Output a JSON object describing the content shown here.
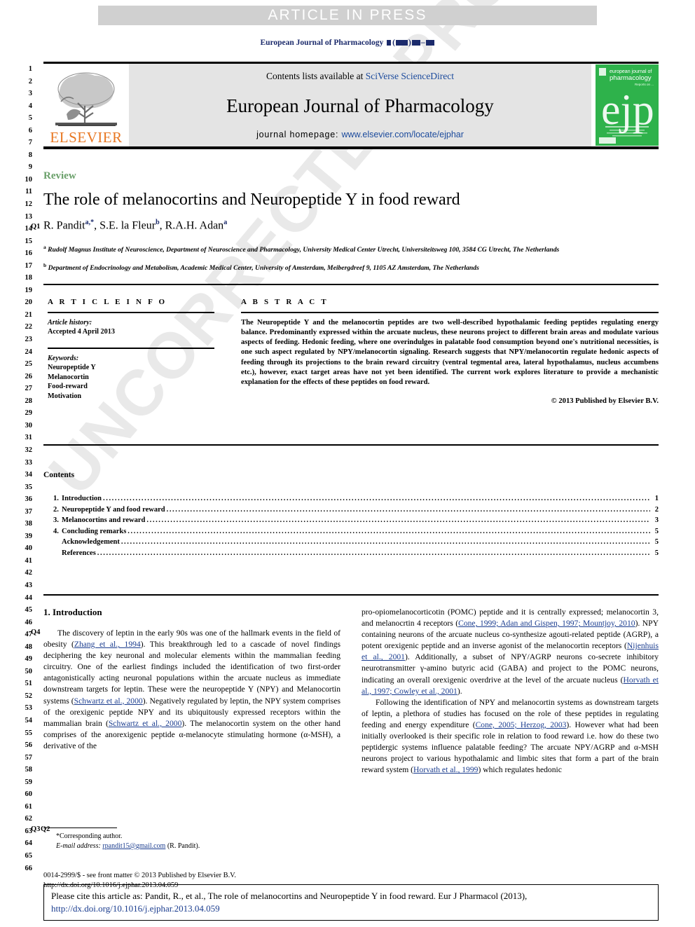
{
  "header": {
    "article_in_press": "ARTICLE IN PRESS",
    "running_head_prefix": "European Journal of Pharmacology"
  },
  "masthead": {
    "contents_prefix": "Contents lists available at ",
    "contents_link": "SciVerse ScienceDirect",
    "journal_name": "European Journal of Pharmacology",
    "homepage_prefix": "journal homepage: ",
    "homepage_link": "www.elsevier.com/locate/ejphar",
    "publisher": "ELSEVIER",
    "cover_title_line1": "european journal of",
    "cover_title_line2": "pharmacology",
    "cover_logo": "ejp"
  },
  "article": {
    "type_label": "Review",
    "title": "The role of melanocortins and Neuropeptide Y in food reward",
    "authors_html": "R. Pandit, S.E. la Fleur, R.A.H. Adan",
    "author1": "R. Pandit",
    "author1_sup": "a,*",
    "author2": "S.E. la Fleur",
    "author2_sup": "b",
    "author3": "R.A.H. Adan",
    "author3_sup": "a",
    "affiliation_a": "Rudolf Magnus Institute of Neuroscience, Department of Neuroscience and Pharmacology, University Medical Center Utrecht, Universiteitsweg 100, 3584 CG Utrecht, The Netherlands",
    "affiliation_b": "Department of Endocrinology and Metabolism, Academic Medical Center, University of Amsterdam, Meibergdreef 9, 1105 AZ Amsterdam, The Netherlands"
  },
  "info": {
    "heading": "A R T I C L E   I N F O",
    "history_label": "Article history:",
    "history_value": "Accepted 4 April 2013",
    "keywords_label": "Keywords:",
    "keywords": [
      "Neuropeptide Y",
      "Melanocortin",
      "Food-reward",
      "Motivation"
    ]
  },
  "abstract": {
    "heading": "A B S T R A C T",
    "text": "The Neuropeptide Y and the melanocortin peptides are two well-described hypothalamic feeding peptides regulating energy balance. Predominantly expressed within the arcuate nucleus, these neurons project to different brain areas and modulate various aspects of feeding. Hedonic feeding, where one overindulges in palatable food consumption beyond one's nutritional necessities, is one such aspect regulated by NPY/melanocortin signaling. Research suggests that NPY/melanocortin regulate hedonic aspects of feeding through its projections to the brain reward circuitry (ventral tegmental area, lateral hypothalamus, nucleus accumbens etc.), however, exact target areas have not yet been identified. The current work explores literature to provide a mechanistic explanation for the effects of these peptides on food reward.",
    "copyright": "© 2013 Published by Elsevier B.V."
  },
  "contents": {
    "heading": "Contents",
    "entries": [
      {
        "num": "1.",
        "label": "Introduction",
        "page": "1"
      },
      {
        "num": "2.",
        "label": "Neuropeptide Y and food reward",
        "page": "2"
      },
      {
        "num": "3.",
        "label": "Melanocortins and reward",
        "page": "3"
      },
      {
        "num": "4.",
        "label": "Concluding remarks",
        "page": "5"
      },
      {
        "num": "",
        "label": "Acknowledgement",
        "page": "5"
      },
      {
        "num": "",
        "label": "References",
        "page": "5"
      }
    ]
  },
  "body": {
    "section1_heading": "1.  Introduction",
    "left_para1_a": "The discovery of leptin in the early 90s was one of the hallmark events in the field of obesity (",
    "left_para1_ref1": "Zhang et al., 1994",
    "left_para1_b": "). This breakthrough led to a cascade of novel findings deciphering the key neuronal and molecular elements within the mammalian feeding circuitry. One of the earliest findings included the identification of two first-order antagonistically acting neuronal populations within the arcuate nucleus as immediate downstream targets for leptin. These were the neuropeptide Y (NPY) and Melanocortin systems (",
    "left_para1_ref2": "Schwartz et al., 2000",
    "left_para1_c": "). Negatively regulated by leptin, the NPY system comprises of the orexigenic peptide NPY and its ubiquitously expressed receptors within the mammalian brain (",
    "left_para1_ref3": "Schwartz et al., 2000",
    "left_para1_d": "). The melanocortin system on the other hand comprises of the anorexigenic peptide α-melanocyte stimulating hormone (α-MSH), a derivative of the ",
    "right_para1_a": "pro-opiomelanocorticotin (POMC) peptide and it is centrally expressed; melanocortin 3, and melanocrtin 4 receptors (",
    "right_para1_ref1": "Cone, 1999; Adan and Gispen, 1997; Mountjoy, 2010",
    "right_para1_b": "). NPY containing neurons of the arcuate nucleus co-synthesize agouti-related peptide (AGRP), a potent orexigenic peptide and an inverse agonist of the melanocortin receptors (",
    "right_para1_ref2": "Nijenhuis et al., 2001",
    "right_para1_c": "). Additionally, a subset of NPY/AGRP neurons co-secrete inhibitory neurotransmitter γ-amino butyric acid (GABA) and project to the POMC neurons, indicating an overall orexigenic overdrive at the level of the arcuate nucleus (",
    "right_para1_ref3": "Horvath et al., 1997; Cowley et al., 2001",
    "right_para1_d": ").",
    "right_para2_a": "Following the identification of NPY and melanocortin systems as downstream targets of leptin, a plethora of studies has focused on the role of these peptides in regulating feeding and energy expenditure (",
    "right_para2_ref1": "Cone, 2005; Herzog, 2003",
    "right_para2_b": "). However what had been initially overlooked is their specific role in relation to food reward i.e. how do these two peptidergic systems influence palatable feeding? The arcuate NPY/AGRP and α-MSH neurons project to various hypothalamic and limbic sites that form a part of the brain reward system (",
    "right_para2_ref2": "Horvath et al., 1999",
    "right_para2_c": ") which regulates hedonic"
  },
  "footnote": {
    "corresponding": "*Corresponding author.",
    "email_label": "E-mail address:",
    "email": "rpandit15@gmail.com",
    "email_author": " (R. Pandit)."
  },
  "imprint": {
    "line1": "0014-2999/$ - see front matter © 2013 Published by Elsevier B.V.",
    "line2": "http://dx.doi.org/10.1016/j.ejphar.2013.04.059"
  },
  "cite_box": {
    "text_a": "Please cite this article as: Pandit, R., et al., The role of melanocortins and Neuropeptide Y in food reward. Eur J Pharmacol (2013), ",
    "link": "http://dx.doi.org/10.1016/j.ejphar.2013.04.059"
  },
  "watermark": {
    "text": "UNCORRECTED PROOF"
  },
  "line_numbers": {
    "start": 1,
    "end": 66,
    "query_marks": [
      {
        "label": "Q1",
        "line": 14
      },
      {
        "label": "Q4",
        "line": 47
      },
      {
        "label": "Q3",
        "line": 63
      },
      {
        "label": "Q2",
        "line": 63
      }
    ]
  },
  "colors": {
    "link": "#1b3d8f",
    "elsevier_orange": "#E87722",
    "review_green": "#6aa06a",
    "band_gray": "#d0d0d0",
    "cover_green": "#2eb24b"
  }
}
